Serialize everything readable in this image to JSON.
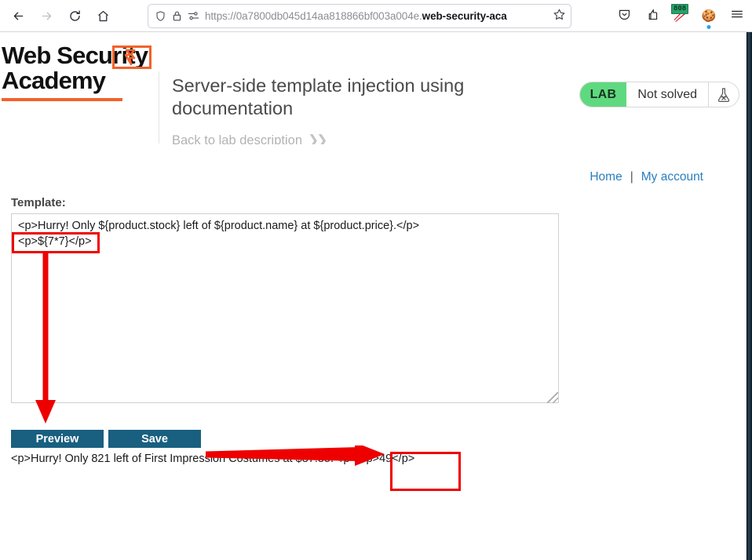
{
  "browser": {
    "back_icon": "back-arrow-icon",
    "forward_icon": "forward-arrow-icon",
    "reload_icon": "reload-icon",
    "home_icon": "home-icon",
    "shield_icon": "shield-icon",
    "lock_icon": "padlock-icon",
    "permissions_icon": "permissions-icon",
    "url_prefix": "https://0a7800db045d14aa818866bf003a004e.",
    "url_highlight": "web-security-aca",
    "bookmark_icon": "star-icon",
    "pocket_icon": "pocket-icon",
    "share_icon": "share-icon",
    "extension_badge": "808",
    "extension_icon": "extension-icon",
    "cookie_icon": "cookie-icon",
    "menu_icon": "hamburger-menu-icon"
  },
  "header": {
    "logo_line1": "Web Security",
    "logo_line2": "Academy",
    "logo_mark": "lightning-bolt-icon",
    "lab_title": "Server-side template injection using documentation",
    "back_link": "Back to lab description",
    "back_chevrons": "»",
    "lab_tag": "LAB",
    "lab_status": "Not solved",
    "flask_icon": "flask-icon",
    "accent_color": "#f2622a",
    "status_color": "#5fd97f"
  },
  "page": {
    "nav": {
      "home": "Home",
      "separator": "|",
      "my_account": "My account"
    },
    "template_label": "Template:",
    "template_value": "<p>Hurry! Only ${product.stock} left of ${product.name} at ${product.price}.</p>\n<p>${7*7}</p>",
    "buttons": {
      "preview": "Preview",
      "save": "Save"
    },
    "output_text": "<p>Hurry! Only 821 left of First Impression Costumes at $87.85.</p> <p>49</p>",
    "button_color": "#195f7f",
    "link_color": "#2a7fbe"
  },
  "annotations": {
    "color": "#ee0000",
    "highlight_template_payload": "<p>${7*7}</p>",
    "highlight_output_result": "<p>49</p>",
    "arrow_down": "arrow-pointing-to-preview-button",
    "arrow_right": "arrow-pointing-to-output-result"
  }
}
